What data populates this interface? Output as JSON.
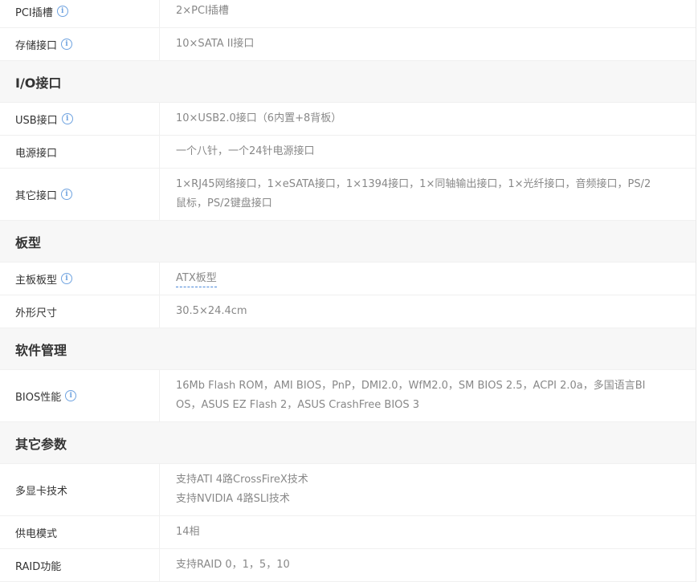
{
  "rows": {
    "pci_slots": {
      "label": "PCI插槽",
      "value": "2×PCI插槽"
    },
    "storage": {
      "label": "存储接口",
      "value": "10×SATA II接口"
    },
    "io_section": "I/O接口",
    "usb": {
      "label": "USB接口",
      "value": "10×USB2.0接口（6内置+8背板）"
    },
    "power": {
      "label": "电源接口",
      "value": "一个八针，一个24针电源接口"
    },
    "other_ports": {
      "label": "其它接口",
      "value_line1": "1×RJ45网络接口，1×eSATA接口，1×1394接口，1×同轴输出接口，1×光纤接口，音频接口，PS/2",
      "value_line2": "鼠标，PS/2键盘接口"
    },
    "board_section": "板型",
    "form_factor": {
      "label": "主板板型",
      "value": "ATX板型"
    },
    "dimensions": {
      "label": "外形尺寸",
      "value": "30.5×24.4cm"
    },
    "software_section": "软件管理",
    "bios": {
      "label": "BIOS性能",
      "value_line1": "16Mb Flash ROM，AMI BIOS，PnP，DMI2.0，WfM2.0，SM BIOS 2.5，ACPI 2.0a，多国语言BI",
      "value_line2": "OS，ASUS EZ Flash 2，ASUS CrashFree BIOS 3"
    },
    "other_section": "其它参数",
    "multi_gpu": {
      "label": "多显卡技术",
      "value_line1": "支持ATI 4路CrossFireX技术",
      "value_line2": "支持NVIDIA 4路SLI技术"
    },
    "power_phase": {
      "label": "供电模式",
      "value": "14相"
    },
    "raid": {
      "label": "RAID功能",
      "value": "支持RAID 0，1，5，10"
    }
  },
  "icons": {
    "info": "info-icon",
    "info_glyph": "i"
  },
  "colors": {
    "info_icon": "#6fa3e0",
    "section_bg": "#f7f7f7",
    "value_text": "#888888",
    "link_underline": "#4a88d8"
  }
}
